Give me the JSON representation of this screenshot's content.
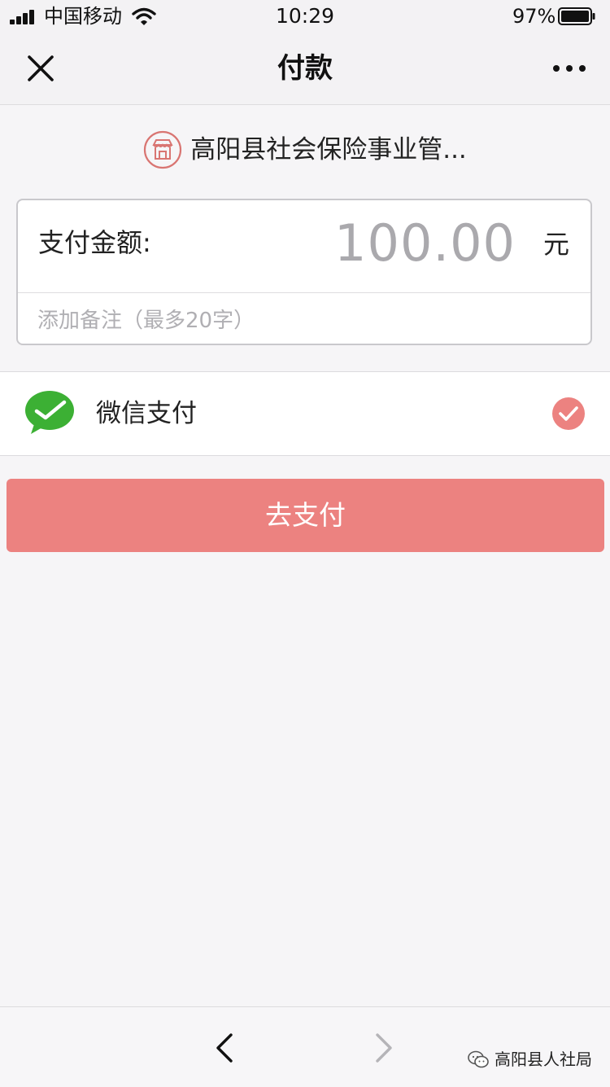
{
  "status_bar": {
    "carrier": "中国移动",
    "time": "10:29",
    "battery": "97%"
  },
  "nav": {
    "title": "付款"
  },
  "merchant": {
    "name": "高阳县社会保险事业管..."
  },
  "amount": {
    "label": "支付金额:",
    "value": "100.00",
    "unit": "元",
    "remark_placeholder": "添加备注（最多20字）"
  },
  "payment_method": {
    "label": "微信支付",
    "selected": true
  },
  "pay_button": {
    "label": "去支付"
  },
  "watermark": {
    "text": "高阳县人社局"
  },
  "colors": {
    "accent": "#ec8280",
    "wechat_green": "#3cb034"
  }
}
